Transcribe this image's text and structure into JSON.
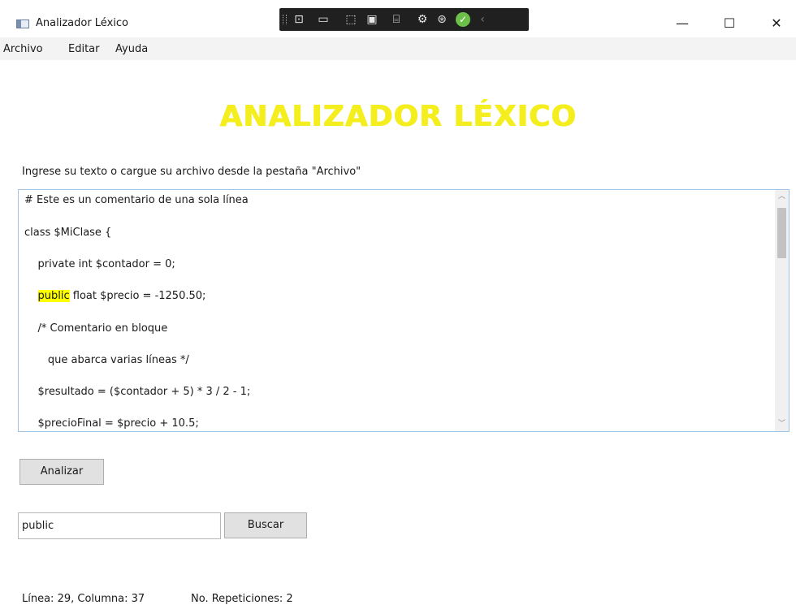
{
  "window": {
    "title": "Analizador Léxico",
    "controls": {
      "minimize": "—",
      "maximize": "☐",
      "close": "✕"
    }
  },
  "debug_toolbar": {
    "icons": [
      "select-element-icon",
      "video-icon",
      "pointer-icon",
      "layout-adorner-icon",
      "track-focus-icon",
      "hot-reload-icon",
      "accessibility-icon",
      "check-icon",
      "chevron-left-icon"
    ]
  },
  "menu": {
    "items": [
      "Archivo",
      "Editar",
      "Ayuda"
    ]
  },
  "main": {
    "heading": "ANALIZADOR LÉXICO",
    "heading_color": "#f5ee1e",
    "instruction": "Ingrese su texto o cargue su archivo desde la pestaña \"Archivo\"",
    "code_lines": [
      "# Este es un comentario de una sola línea",
      "class $MiClase {",
      "    private int $contador = 0;",
      "public",
      "    /* Comentario en bloque",
      "       que abarca varias líneas */",
      "    $resultado = ($contador + 5) * 3 / 2 - 1;",
      "    $precioFinal = $precio + 10.5;"
    ],
    "highlighted_line_rest": " float $precio = -1250.50;",
    "highlight_color": "#ffff00",
    "analyze_label": "Analizar",
    "search_value": "public",
    "search_label": "Buscar"
  },
  "status": {
    "position": "Línea: 29, Columna: 37",
    "repetitions": "No. Repeticiones: 2"
  }
}
